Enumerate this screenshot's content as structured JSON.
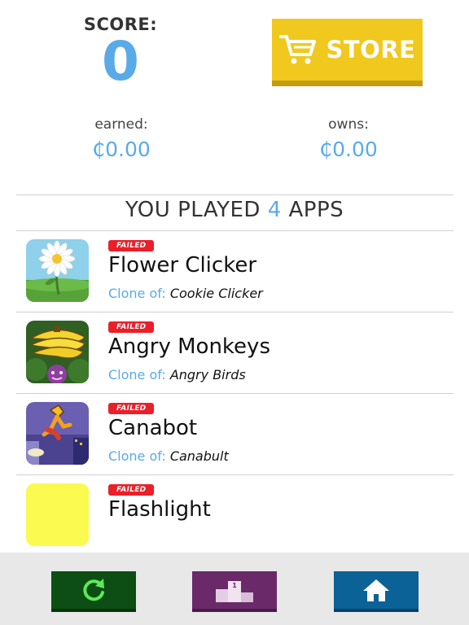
{
  "score": {
    "label": "SCORE:",
    "value": "0"
  },
  "store": {
    "label": "STORE",
    "icon": "cart-icon"
  },
  "stats": {
    "earned": {
      "label": "earned:",
      "value": "₵0.00"
    },
    "owns": {
      "label": "owns:",
      "value": "₵0.00"
    }
  },
  "played": {
    "prefix": "YOU PLAYED",
    "count": "4",
    "suffix": "APPS"
  },
  "apps": [
    {
      "badge": "FAILED",
      "title": "Flower Clicker",
      "clone_label": "Clone of:",
      "clone_of": "Cookie Clicker",
      "icon": "flower-icon"
    },
    {
      "badge": "FAILED",
      "title": "Angry Monkeys",
      "clone_label": "Clone of:",
      "clone_of": "Angry Birds",
      "icon": "bananas-icon"
    },
    {
      "badge": "FAILED",
      "title": "Canabot",
      "clone_label": "Clone of:",
      "clone_of": "Canabult",
      "icon": "runner-icon"
    },
    {
      "badge": "FAILED",
      "title": "Flashlight",
      "icon": "yellow-square-icon"
    }
  ],
  "nav": {
    "replay": {
      "icon": "replay-icon",
      "color": "#0c4e14"
    },
    "leaderboard": {
      "icon": "podium-icon",
      "color": "#6a2a6a",
      "rank": "1"
    },
    "home": {
      "icon": "home-icon",
      "color": "#0b6296"
    }
  },
  "colors": {
    "accent": "#5aaae8",
    "store": "#f0c81e",
    "failed": "#e9202a"
  }
}
